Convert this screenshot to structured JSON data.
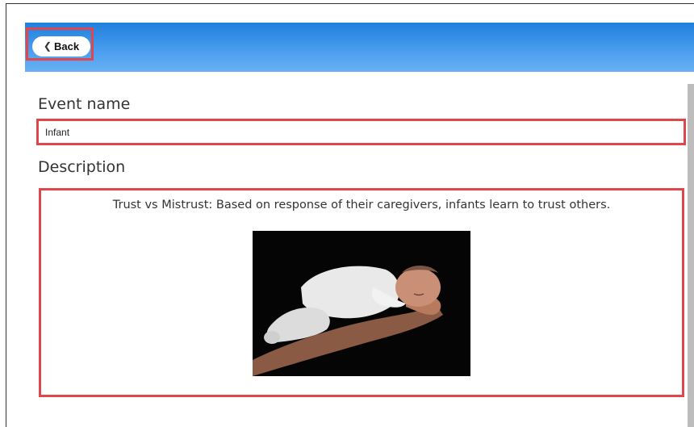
{
  "header": {
    "back_label": "Back"
  },
  "form": {
    "event_name_label": "Event name",
    "event_name_value": "Infant",
    "description_label": "Description",
    "description_text": "Trust vs Mistrust: Based on response of their caregivers, infants learn to trust others."
  },
  "colors": {
    "header_gradient_top": "#1f7fdc",
    "header_gradient_bottom": "#6ab0f4",
    "highlight_border": "#e0474c"
  },
  "icons": {
    "back": "chevron-left-icon"
  }
}
